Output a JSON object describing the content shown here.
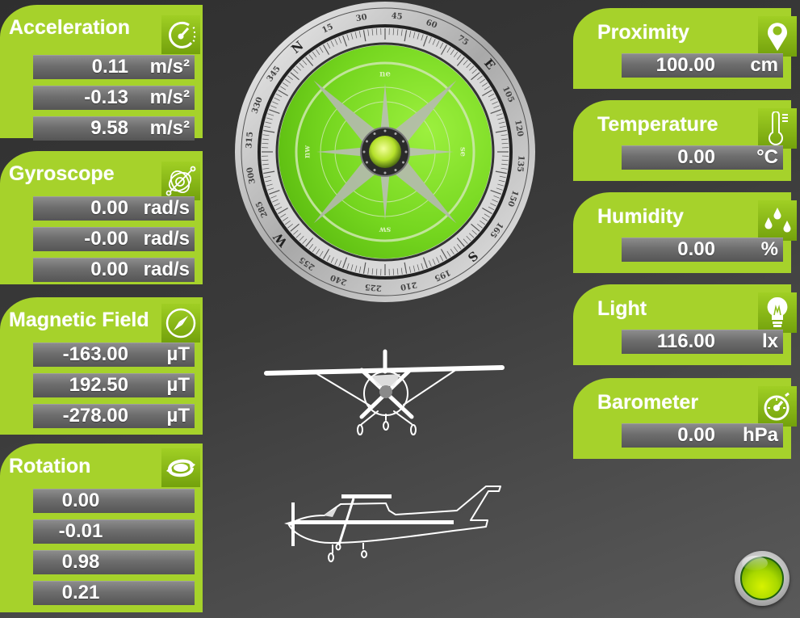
{
  "colors": {
    "panel_green": "#a6d22b",
    "icon_green_dark": "#73a10c",
    "readout_gray": "#6e6e6e",
    "compass_face": "#7fe030",
    "background": "#3a3a3a"
  },
  "left_panels": [
    {
      "title": "Acceleration",
      "icon": "speedometer-icon",
      "readouts": [
        {
          "value": "0.11",
          "unit": "m/s²"
        },
        {
          "value": "-0.13",
          "unit": "m/s²"
        },
        {
          "value": "9.58",
          "unit": "m/s²"
        }
      ]
    },
    {
      "title": "Gyroscope",
      "icon": "gyroscope-icon",
      "readouts": [
        {
          "value": "0.00",
          "unit": "rad/s"
        },
        {
          "value": "-0.00",
          "unit": "rad/s"
        },
        {
          "value": "0.00",
          "unit": "rad/s"
        }
      ]
    },
    {
      "title": "Magnetic Field",
      "icon": "compass-icon",
      "readouts": [
        {
          "value": "-163.00",
          "unit": "µT"
        },
        {
          "value": "192.50",
          "unit": "µT"
        },
        {
          "value": "-278.00",
          "unit": "µT"
        }
      ]
    },
    {
      "title": "Rotation",
      "icon": "rotation-icon",
      "readouts": [
        {
          "value": "0.00"
        },
        {
          "value": "-0.01"
        },
        {
          "value": "0.98"
        },
        {
          "value": "0.21"
        }
      ]
    }
  ],
  "right_panels": [
    {
      "title": "Proximity",
      "icon": "location-pin-icon",
      "value": "100.00",
      "unit": "cm"
    },
    {
      "title": "Temperature",
      "icon": "thermometer-icon",
      "value": "0.00",
      "unit": "°C"
    },
    {
      "title": "Humidity",
      "icon": "water-drops-icon",
      "value": "0.00",
      "unit": "%"
    },
    {
      "title": "Light",
      "icon": "light-bulb-icon",
      "value": "116.00",
      "unit": "lx"
    },
    {
      "title": "Barometer",
      "icon": "stopwatch-gauge-icon",
      "value": "0.00",
      "unit": "hPa"
    }
  ],
  "compass": {
    "heading_deg": 40,
    "cardinal_labels": [
      "N",
      "E",
      "S",
      "W"
    ],
    "degree_labels": [
      "15",
      "30",
      "45",
      "60",
      "75",
      "105",
      "120",
      "135",
      "150",
      "165",
      "195",
      "210",
      "225",
      "240",
      "255",
      "285",
      "300",
      "315",
      "330",
      "345"
    ],
    "rose_labels": [
      "ne",
      "se",
      "sw",
      "nw"
    ]
  },
  "attitude": {
    "front_view": "airplane-front-view",
    "side_view": "airplane-side-view"
  },
  "power_button": {
    "state": "on"
  }
}
